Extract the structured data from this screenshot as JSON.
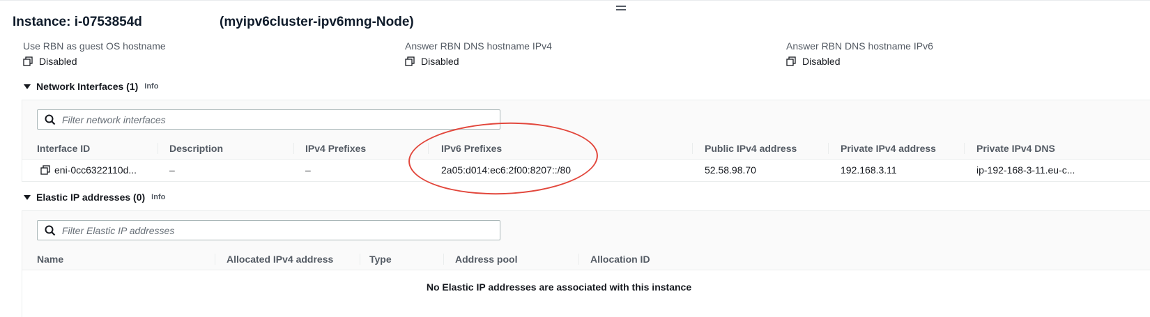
{
  "header": {
    "instance_label": "Instance: i-0753854d",
    "instance_name": "(myipv6cluster-ipv6mng-Node)"
  },
  "details": [
    {
      "label": "Use RBN as guest OS hostname",
      "value": "Disabled"
    },
    {
      "label": "Answer RBN DNS hostname IPv4",
      "value": "Disabled"
    },
    {
      "label": "Answer RBN DNS hostname IPv6",
      "value": "Disabled"
    }
  ],
  "network_interfaces": {
    "title": "Network Interfaces (1)",
    "info": "Info",
    "search_placeholder": "Filter network interfaces",
    "columns": [
      "Interface ID",
      "Description",
      "IPv4 Prefixes",
      "IPv6 Prefixes",
      "Public IPv4 address",
      "Private IPv4 address",
      "Private IPv4 DNS"
    ],
    "rows": [
      {
        "interface_id": "eni-0cc6322110d...",
        "description": "–",
        "ipv4_prefixes": "–",
        "ipv6_prefixes": "2a05:d014:ec6:2f00:8207::/80",
        "public_ipv4": "52.58.98.70",
        "private_ipv4": "192.168.3.11",
        "private_dns": "ip-192-168-3-11.eu-c..."
      }
    ]
  },
  "elastic_ips": {
    "title": "Elastic IP addresses (0)",
    "info": "Info",
    "search_placeholder": "Filter Elastic IP addresses",
    "columns": [
      "Name",
      "Allocated IPv4 address",
      "Type",
      "Address pool",
      "Allocation ID"
    ],
    "empty_message": "No Elastic IP addresses are associated with this instance"
  },
  "colors": {
    "highlight": "#e2473c",
    "header_text": "#545b64"
  },
  "icons": [
    "drag-handle-icon",
    "copy-icon",
    "caret-down-icon",
    "search-icon"
  ]
}
